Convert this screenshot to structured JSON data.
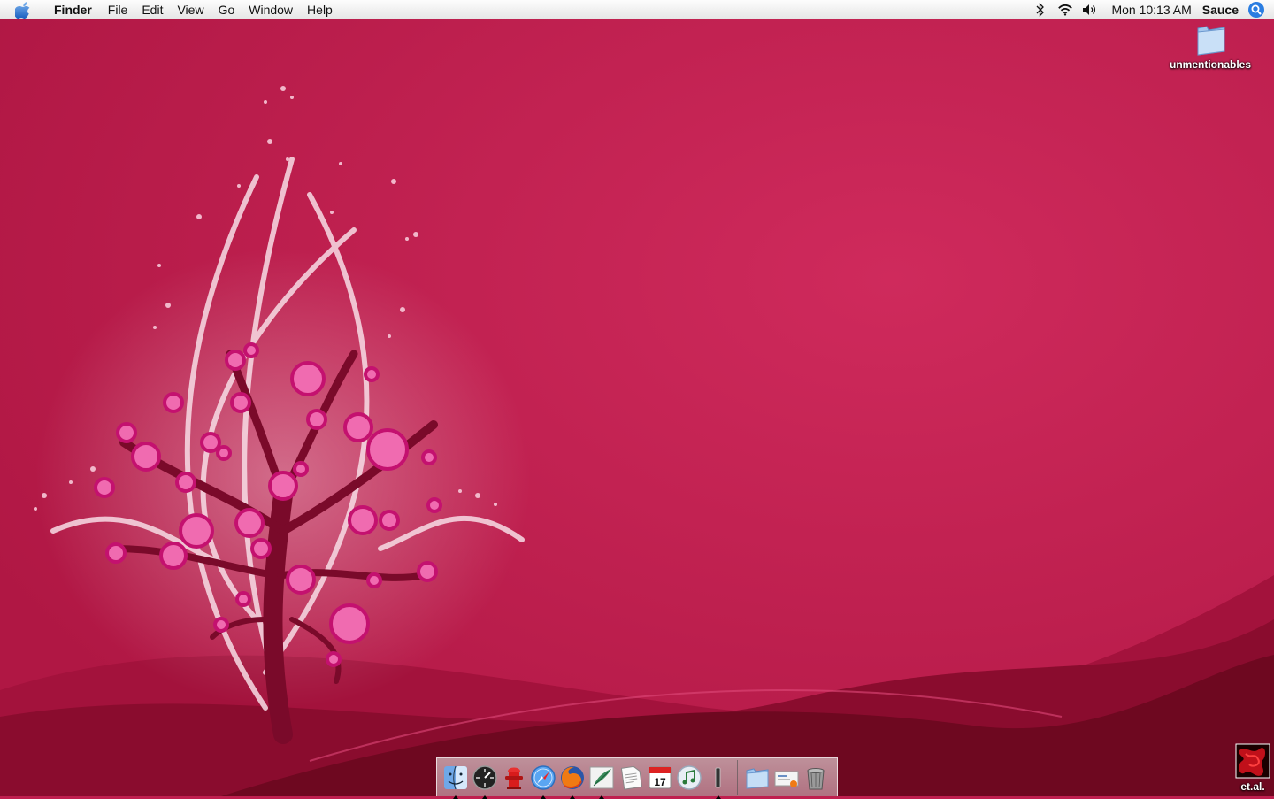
{
  "menubar": {
    "app_name": "Finder",
    "menus": [
      "File",
      "Edit",
      "View",
      "Go",
      "Window",
      "Help"
    ],
    "clock": "Mon 10:13 AM",
    "user": "Sauce",
    "status_icons": [
      "bluetooth-icon",
      "wifi-icon",
      "volume-icon"
    ]
  },
  "desktop": {
    "icons": [
      {
        "label": "unmentionables",
        "icon": "folder-icon"
      },
      {
        "label": "et.al.",
        "icon": "image-file-icon"
      }
    ]
  },
  "dock": {
    "apps": [
      {
        "name": "finder-icon",
        "running": true
      },
      {
        "name": "dashboard-icon",
        "running": true
      },
      {
        "name": "fire-hydrant-icon",
        "running": false
      },
      {
        "name": "safari-icon",
        "running": true
      },
      {
        "name": "firefox-icon",
        "running": true
      },
      {
        "name": "mail-feather-icon",
        "running": true
      },
      {
        "name": "text-document-icon",
        "running": false
      },
      {
        "name": "ical-icon",
        "running": false,
        "date": "17"
      },
      {
        "name": "itunes-icon",
        "running": false
      },
      {
        "name": "terminal-icon",
        "running": true
      }
    ],
    "docs": [
      {
        "name": "folder-icon"
      },
      {
        "name": "mail-envelope-icon"
      },
      {
        "name": "trash-icon"
      }
    ]
  },
  "colors": {
    "wallpaper": "#c01f4f",
    "wave_dark": "#7c0a24",
    "blossom": "#f06bb0"
  }
}
